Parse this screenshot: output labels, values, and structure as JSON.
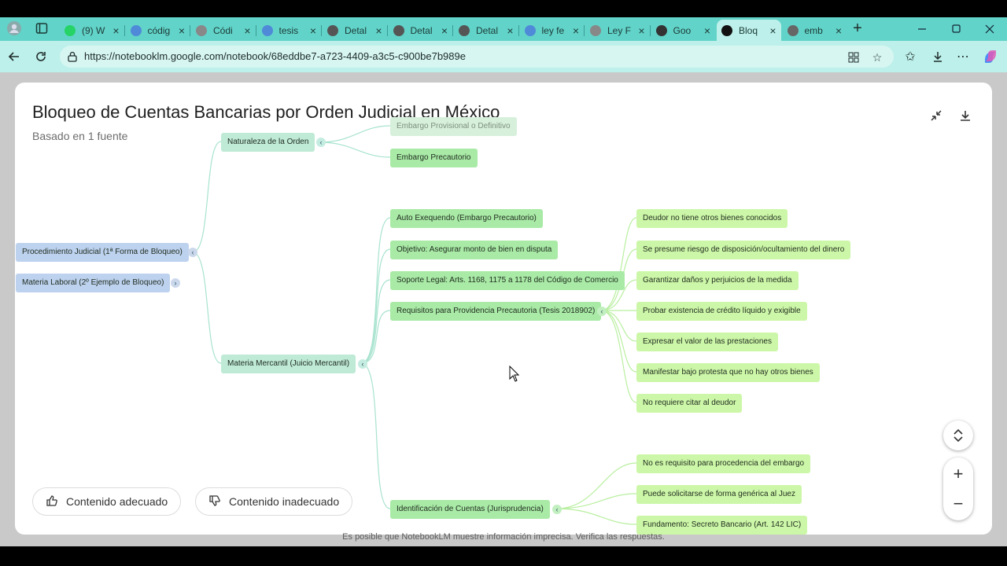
{
  "browser": {
    "tabs": [
      {
        "label": "(9) W",
        "color": "#25d366"
      },
      {
        "label": "códig",
        "color": "#4f8ad8"
      },
      {
        "label": "Códi",
        "color": "#888888"
      },
      {
        "label": "tesis",
        "color": "#4f8ad8"
      },
      {
        "label": "Detal",
        "color": "#555555"
      },
      {
        "label": "Detal",
        "color": "#555555"
      },
      {
        "label": "Detal",
        "color": "#555555"
      },
      {
        "label": "ley fe",
        "color": "#4f8ad8"
      },
      {
        "label": "Ley F",
        "color": "#888888"
      },
      {
        "label": "Goo",
        "color": "#333333"
      },
      {
        "label": "Bloq",
        "color": "#111111"
      },
      {
        "label": "emb",
        "color": "#666666"
      }
    ],
    "active_tab_index": 10,
    "url": "https://notebooklm.google.com/notebook/68eddbe7-a723-4409-a3c5-c900be7b989e"
  },
  "mindmap": {
    "title": "Bloqueo de Cuentas Bancarias por Orden Judicial en México",
    "subtitle": "Basado en 1 fuente",
    "nodes": {
      "root1": "Procedimiento Judicial (1ª Forma de Bloqueo)",
      "root2": "Materia Laboral (2º Ejemplo de Bloqueo)",
      "naturaleza": "Naturaleza de la Orden",
      "embargo_prov": "Embargo Provisional o Definitivo",
      "embargo_prec": "Embargo Precautorio",
      "mercantil": "Materia Mercantil (Juicio Mercantil)",
      "auto": "Auto Exequendo (Embargo Precautorio)",
      "objetivo": "Objetivo: Asegurar monto de bien en disputa",
      "soporte": "Soporte Legal: Arts. 1168, 1175 a 1178 del Código de Comercio",
      "requisitos": "Requisitos para Providencia Precautoria (Tesis 2018902)",
      "identificacion": "Identificación de Cuentas (Jurisprudencia)",
      "req": [
        "Deudor no tiene otros bienes conocidos",
        "Se presume riesgo de disposición/ocultamiento del dinero",
        "Garantizar daños y perjuicios de la medida",
        "Probar existencia de crédito líquido y exigible",
        "Expresar el valor de las prestaciones",
        "Manifestar bajo protesta que no hay otros bienes",
        "No requiere citar al deudor"
      ],
      "ident": [
        "No es requisito para procedencia del embargo",
        "Puede solicitarse de forma genérica al Juez",
        "Fundamento: Secreto Bancario (Art. 142 LIC)"
      ]
    },
    "feedback": {
      "good": "Contenido adecuado",
      "bad": "Contenido inadecuado"
    }
  },
  "disclaimer": "Es posible que NotebookLM muestre información imprecisa. Verifica las respuestas."
}
